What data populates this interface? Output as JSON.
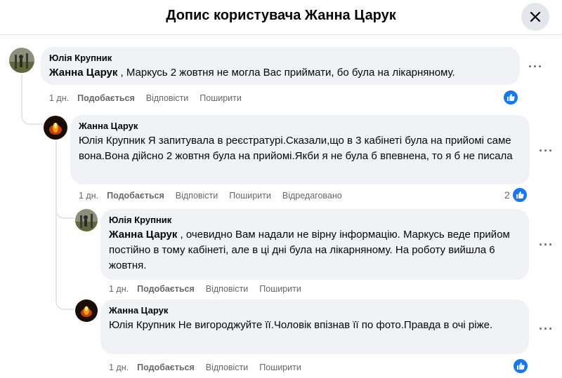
{
  "header": {
    "title": "Допис користувача Жанна Царук"
  },
  "comments": [
    {
      "author": "Юлія Крупник",
      "mention": "Жанна Царук",
      "text": " , Маркусь 2 жовтня не могла Вас приймати, бо була на лікарняному.",
      "time": "1 дн.",
      "like": "Подобається",
      "reply": "Відповісти",
      "share": "Поширити"
    },
    {
      "author": "Жанна Царук",
      "mention": "",
      "text": "Юлія Крупник Я запитувала в реєстратурі.Сказали,що в 3 кабінеті була на прийомі саме вона.Вона дійсно 2 жовтня була на прийомі.Якби я не була б впевнена, то я б не писала",
      "time": "1 дн.",
      "like": "Подобається",
      "reply": "Відповісти",
      "share": "Поширити",
      "edited": "Відредаговано",
      "reactions": "2"
    },
    {
      "author": "Юлія Крупник",
      "mention": "Жанна Царук",
      "text": " , очевидно Вам надали не вірну інформацію. Маркусь веде прийом постійно в тому кабінеті, але в ці дні була на лікарняному. На роботу вийшла 6 жовтня.",
      "time": "1 дн.",
      "like": "Подобається",
      "reply": "Відповісти",
      "share": "Поширити"
    },
    {
      "author": "Жанна Царук",
      "mention": "",
      "text": "Юлія Крупник Не вигороджуйте її.Чоловік впізнав її по фото.Правда в очі ріже.",
      "time": "1 дн.",
      "like": "Подобається",
      "reply": "Відповісти",
      "share": "Поширити"
    }
  ],
  "icons": {
    "close": "close-icon",
    "more": "more-options-icon",
    "like": "like-icon",
    "like_color": "#1877f2"
  }
}
